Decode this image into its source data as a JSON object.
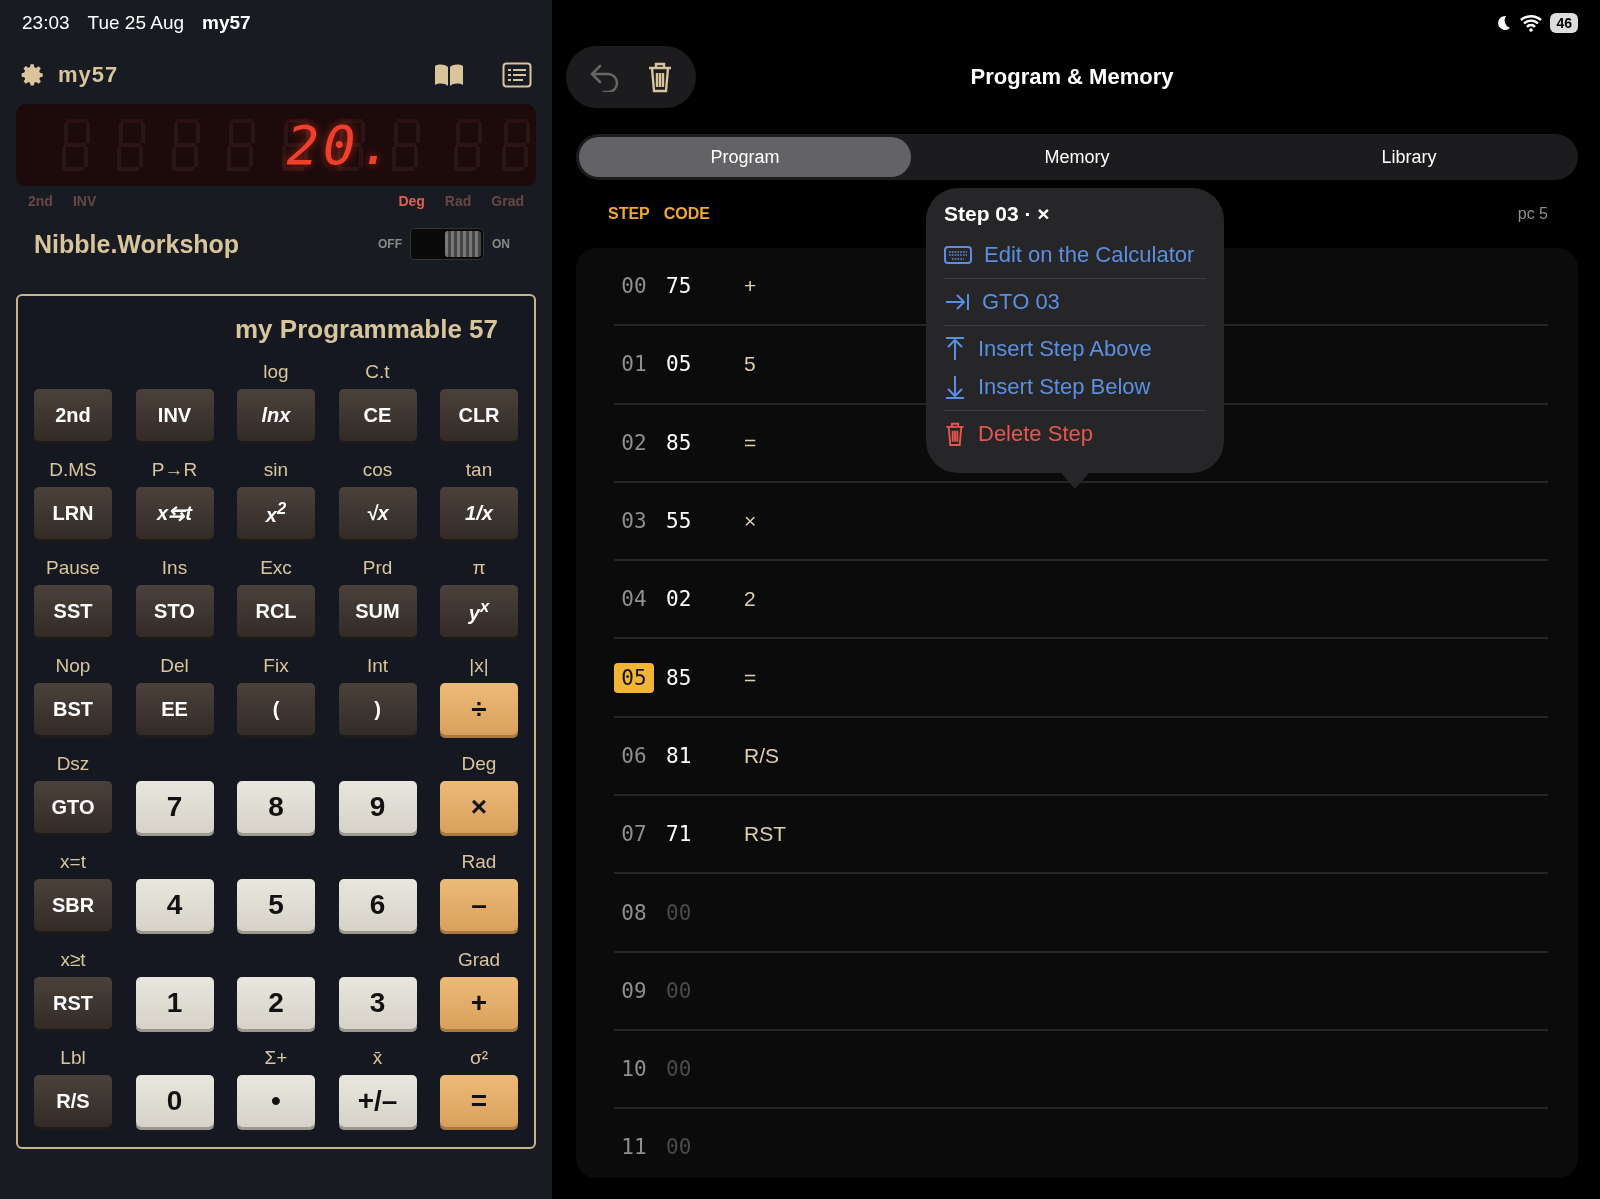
{
  "status_bar": {
    "time": "23:03",
    "date": "Tue 25 Aug",
    "app": "my57",
    "battery": "46"
  },
  "calculator": {
    "name": "my57",
    "display": {
      "value": "20."
    },
    "indicators": [
      {
        "label": "2nd",
        "on": false
      },
      {
        "label": "INV",
        "on": false
      },
      {
        "label": "Deg",
        "on": true
      },
      {
        "label": "Rad",
        "on": false
      },
      {
        "label": "Grad",
        "on": false
      }
    ],
    "brand": "Nibble.Workshop",
    "switch": {
      "off_label": "OFF",
      "on_label": "ON",
      "on": true
    },
    "model": "my Programmable 57",
    "keys": [
      {
        "label": "2nd",
        "kind": "dark"
      },
      {
        "label": "INV",
        "kind": "dark"
      },
      {
        "fn": "log",
        "label": "lnx",
        "kind": "dark",
        "italic": true
      },
      {
        "fn": "C.t",
        "label": "CE",
        "kind": "dark"
      },
      {
        "label": "CLR",
        "kind": "dark"
      },
      {
        "fn": "D.MS",
        "label": "LRN",
        "kind": "dark"
      },
      {
        "fn": "P→R",
        "label": "x⇆t",
        "kind": "dark",
        "italic": true
      },
      {
        "fn": "sin",
        "label": "x$^{2}$",
        "kind": "dark",
        "italic": true
      },
      {
        "fn": "cos",
        "label": "√x",
        "kind": "dark",
        "italic": true
      },
      {
        "fn": "tan",
        "label": "1/x",
        "kind": "dark",
        "italic": true
      },
      {
        "fn": "Pause",
        "label": "SST",
        "kind": "dark"
      },
      {
        "fn": "Ins",
        "label": "STO",
        "kind": "dark"
      },
      {
        "fn": "Exc",
        "label": "RCL",
        "kind": "dark"
      },
      {
        "fn": "Prd",
        "label": "SUM",
        "kind": "dark"
      },
      {
        "fn": "π",
        "label": "y$^{x}$",
        "kind": "dark",
        "italic": true
      },
      {
        "fn": "Nop",
        "label": "BST",
        "kind": "dark"
      },
      {
        "fn": "Del",
        "label": "EE",
        "kind": "dark"
      },
      {
        "fn": "Fix",
        "label": "(",
        "kind": "dark"
      },
      {
        "fn": "Int",
        "label": ")",
        "kind": "dark"
      },
      {
        "fn": "|x|",
        "label": "÷",
        "kind": "operator"
      },
      {
        "fn": "Dsz",
        "label": "GTO",
        "kind": "dark"
      },
      {
        "label": "7",
        "kind": "digit"
      },
      {
        "label": "8",
        "kind": "digit"
      },
      {
        "label": "9",
        "kind": "digit"
      },
      {
        "fn": "Deg",
        "label": "×",
        "kind": "operator"
      },
      {
        "fn": "x=t",
        "label": "SBR",
        "kind": "dark"
      },
      {
        "label": "4",
        "kind": "digit"
      },
      {
        "label": "5",
        "kind": "digit"
      },
      {
        "label": "6",
        "kind": "digit"
      },
      {
        "fn": "Rad",
        "label": "–",
        "kind": "operator"
      },
      {
        "fn": "x≥t",
        "label": "RST",
        "kind": "dark"
      },
      {
        "label": "1",
        "kind": "digit"
      },
      {
        "label": "2",
        "kind": "digit"
      },
      {
        "label": "3",
        "kind": "digit"
      },
      {
        "fn": "Grad",
        "label": "+",
        "kind": "operator"
      },
      {
        "fn": "Lbl",
        "label": "R/S",
        "kind": "dark"
      },
      {
        "label": "0",
        "kind": "digit"
      },
      {
        "fn": "Σ+",
        "label": "•",
        "kind": "digit"
      },
      {
        "fn": "x̄",
        "label": "+/–",
        "kind": "digit"
      },
      {
        "fn": "σ²",
        "label": "=",
        "kind": "operator"
      }
    ]
  },
  "program": {
    "title": "Program & Memory",
    "tabs": [
      {
        "label": "Program",
        "selected": true
      },
      {
        "label": "Memory",
        "selected": false
      },
      {
        "label": "Library",
        "selected": false
      }
    ],
    "columns": [
      "STEP",
      "CODE"
    ],
    "pc": "pc 5",
    "rows": [
      {
        "step": "00",
        "code": "75",
        "mnemonic": "+",
        "selected": false,
        "blank": false
      },
      {
        "step": "01",
        "code": "05",
        "mnemonic": "5",
        "selected": false,
        "blank": false
      },
      {
        "step": "02",
        "code": "85",
        "mnemonic": "=",
        "selected": false,
        "blank": false
      },
      {
        "step": "03",
        "code": "55",
        "mnemonic": "×",
        "selected": false,
        "blank": false
      },
      {
        "step": "04",
        "code": "02",
        "mnemonic": "2",
        "selected": false,
        "blank": false
      },
      {
        "step": "05",
        "code": "85",
        "mnemonic": "=",
        "selected": true,
        "blank": false
      },
      {
        "step": "06",
        "code": "81",
        "mnemonic": "R/S",
        "selected": false,
        "blank": false
      },
      {
        "step": "07",
        "code": "71",
        "mnemonic": "RST",
        "selected": false,
        "blank": false
      },
      {
        "step": "08",
        "code": "00",
        "selected": false,
        "blank": true
      },
      {
        "step": "09",
        "code": "00",
        "selected": false,
        "blank": true
      },
      {
        "step": "10",
        "code": "00",
        "selected": false,
        "blank": true
      },
      {
        "step": "11",
        "code": "00",
        "selected": false,
        "blank": true
      }
    ],
    "popover": {
      "title": "Step 03 · ×",
      "sections": [
        [
          {
            "label": "Edit on the Calculator",
            "destructive": false
          }
        ],
        [
          {
            "label": "GTO 03",
            "destructive": false
          }
        ],
        [
          {
            "label": "Insert Step Above",
            "destructive": false
          },
          {
            "label": "Insert Step Below",
            "destructive": false
          }
        ],
        [
          {
            "label": "Delete Step",
            "destructive": true
          }
        ]
      ]
    }
  }
}
